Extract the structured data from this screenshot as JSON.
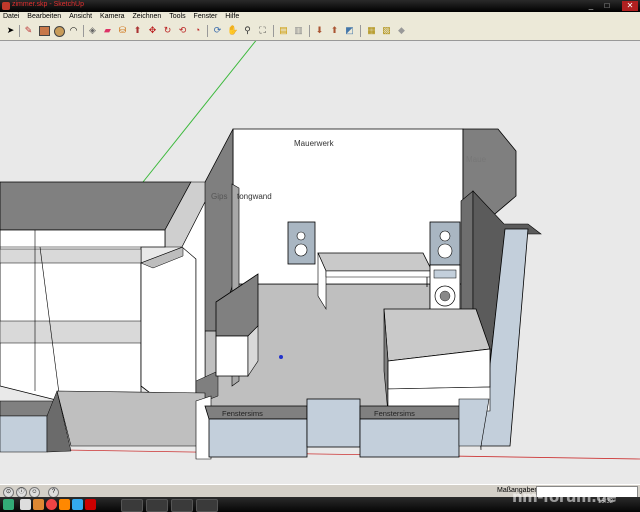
{
  "window": {
    "title": "zimmer.skp - SketchUp"
  },
  "menu": [
    "Datei",
    "Bearbeiten",
    "Ansicht",
    "Kamera",
    "Zeichnen",
    "Tools",
    "Fenster",
    "Hilfe"
  ],
  "toolbar": {
    "tools": [
      "select-icon",
      "pencil-icon",
      "rectangle-icon",
      "circle-icon",
      "arc-icon",
      "make-component-icon",
      "eraser-icon",
      "paint-bucket-icon",
      "push-pull-icon",
      "move-icon",
      "rotate-icon",
      "offset-icon",
      "tape-measure-icon",
      "orbit-icon",
      "pan-icon",
      "zoom-icon",
      "zoom-extents-icon",
      "get-models-icon",
      "share-model-icon",
      "place-model-icon",
      "get-current-view-icon",
      "toggle-terrain-icon",
      "photo-textures-icon",
      "add-location-icon"
    ]
  },
  "scene": {
    "labels": {
      "mauerwerk": "Mauerwerk",
      "mauerwerk_right": "Maue",
      "gipswand": "Gips",
      "betonwand": "tongwand",
      "fenstersims_left": "Fenstersims",
      "fenstersims_right": "Fenstersims"
    },
    "colors": {
      "wall_light": "#ffffff",
      "wall_dark": "#808080",
      "floor": "#bfbfbf",
      "glass": "#c3cfdb",
      "edge": "#000000",
      "axis_green": "#3cb93c",
      "axis_red": "#cc3333",
      "sky": "#e9e9e9"
    }
  },
  "status": {
    "measure_label": "Maßangaben",
    "measure_value": ""
  },
  "taskbar": {
    "time": "15:32"
  },
  "watermark": "nm-forum.de"
}
